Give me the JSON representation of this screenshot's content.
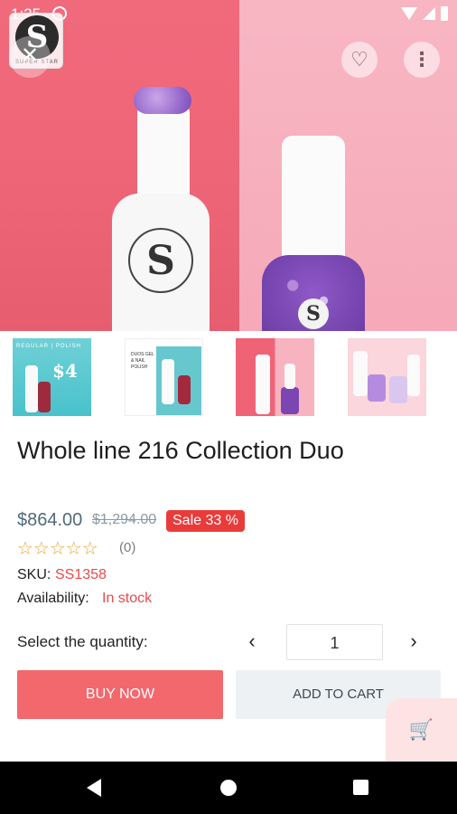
{
  "status_bar": {
    "time": "1:25"
  },
  "store_logo": {
    "letter": "S",
    "tagline": "SUPER STAR"
  },
  "hero": {
    "bottle_logo": "S"
  },
  "thumbnails": {
    "t1": {
      "header": "REGULAR | POLISH",
      "price": "$4"
    },
    "t2": {
      "text": "DUOS GEL & NAIL POLISH"
    }
  },
  "product": {
    "title": "Whole line 216 Collection Duo",
    "price": "$864.00",
    "old_price": "$1,294.00",
    "sale_badge": "Sale 33 %",
    "rating": 0,
    "stars": "☆☆☆☆☆",
    "review_count": "(0)",
    "sku_label": "SKU:",
    "sku_value": "SS1358",
    "availability_label": "Availability:",
    "availability_value": "In stock"
  },
  "quantity": {
    "label": "Select the quantity:",
    "value": "1",
    "prev_icon": "‹",
    "next_icon": "›"
  },
  "actions": {
    "buy_now": "BUY NOW",
    "add_to_cart": "ADD TO CART"
  },
  "icons": {
    "close": "✕",
    "heart": "♡",
    "more": "⋮",
    "cart_add": "🛒"
  },
  "colors": {
    "accent": "#f2686c",
    "sale": "#ea3b3b",
    "stock": "#ea4949",
    "star": "#e9a33a"
  }
}
